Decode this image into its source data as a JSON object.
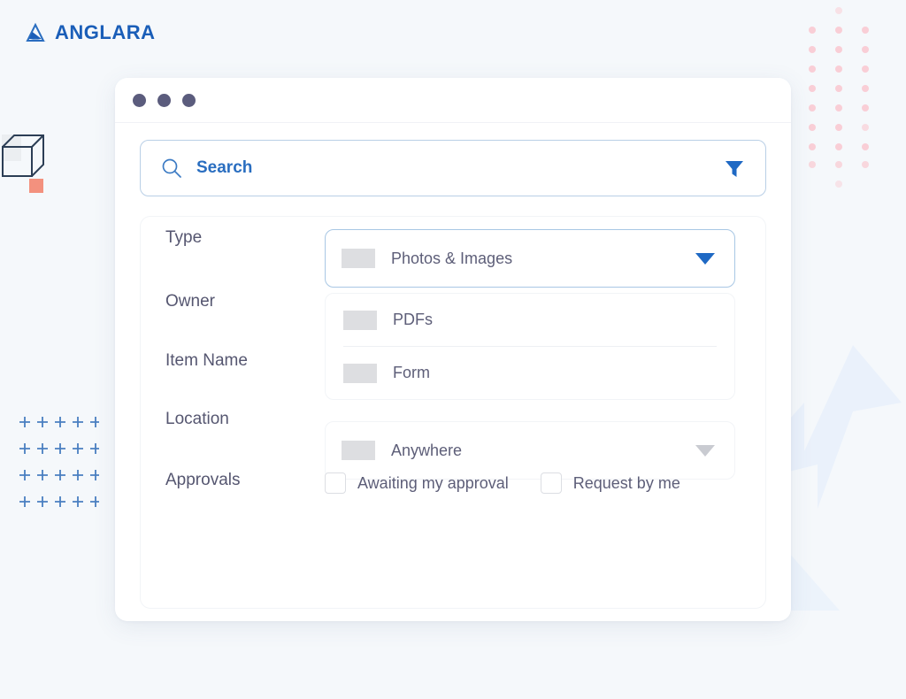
{
  "brand": {
    "name": "ANGLARA",
    "mark_icon": "anglara-triangle-logo-icon",
    "color": "#1a5eb8"
  },
  "window": {
    "traffic_lights": [
      "dot-1",
      "dot-2",
      "dot-3"
    ],
    "dot_color": "#5b5c7d"
  },
  "search": {
    "label": "Search",
    "placeholder": "Search",
    "search_icon": "search-icon",
    "filter_icon": "filter-funnel-icon",
    "accent_color": "#2a6ec0",
    "border_color": "#b9cfe6"
  },
  "filters": {
    "type": {
      "label": "Type",
      "selected": "Photos & Images",
      "caret_icon": "chevron-down-icon",
      "options": [
        "PDFs",
        "Form"
      ]
    },
    "owner": {
      "label": "Owner"
    },
    "item_name": {
      "label": "Item Name"
    },
    "location": {
      "label": "Location",
      "selected": "Anywhere",
      "caret_icon": "chevron-down-icon"
    },
    "approvals": {
      "label": "Approvals",
      "checkboxes": [
        {
          "label": "Awaiting my approval",
          "checked": false
        },
        {
          "label": "Request by me",
          "checked": false
        }
      ]
    }
  },
  "decorations": {
    "cube": "wireframe-cube-decoration",
    "plus_grid": "plus-grid-decoration",
    "pink_dots": "pink-dot-grid-decoration",
    "arrow": "blue-arrow-decoration",
    "plus_color": "#4a7fc1",
    "dot_color": "#f9d2d8",
    "arrow_color": "#e4eefb",
    "cube_color": "#2c3e55",
    "cube_accent": "#f3917e"
  }
}
